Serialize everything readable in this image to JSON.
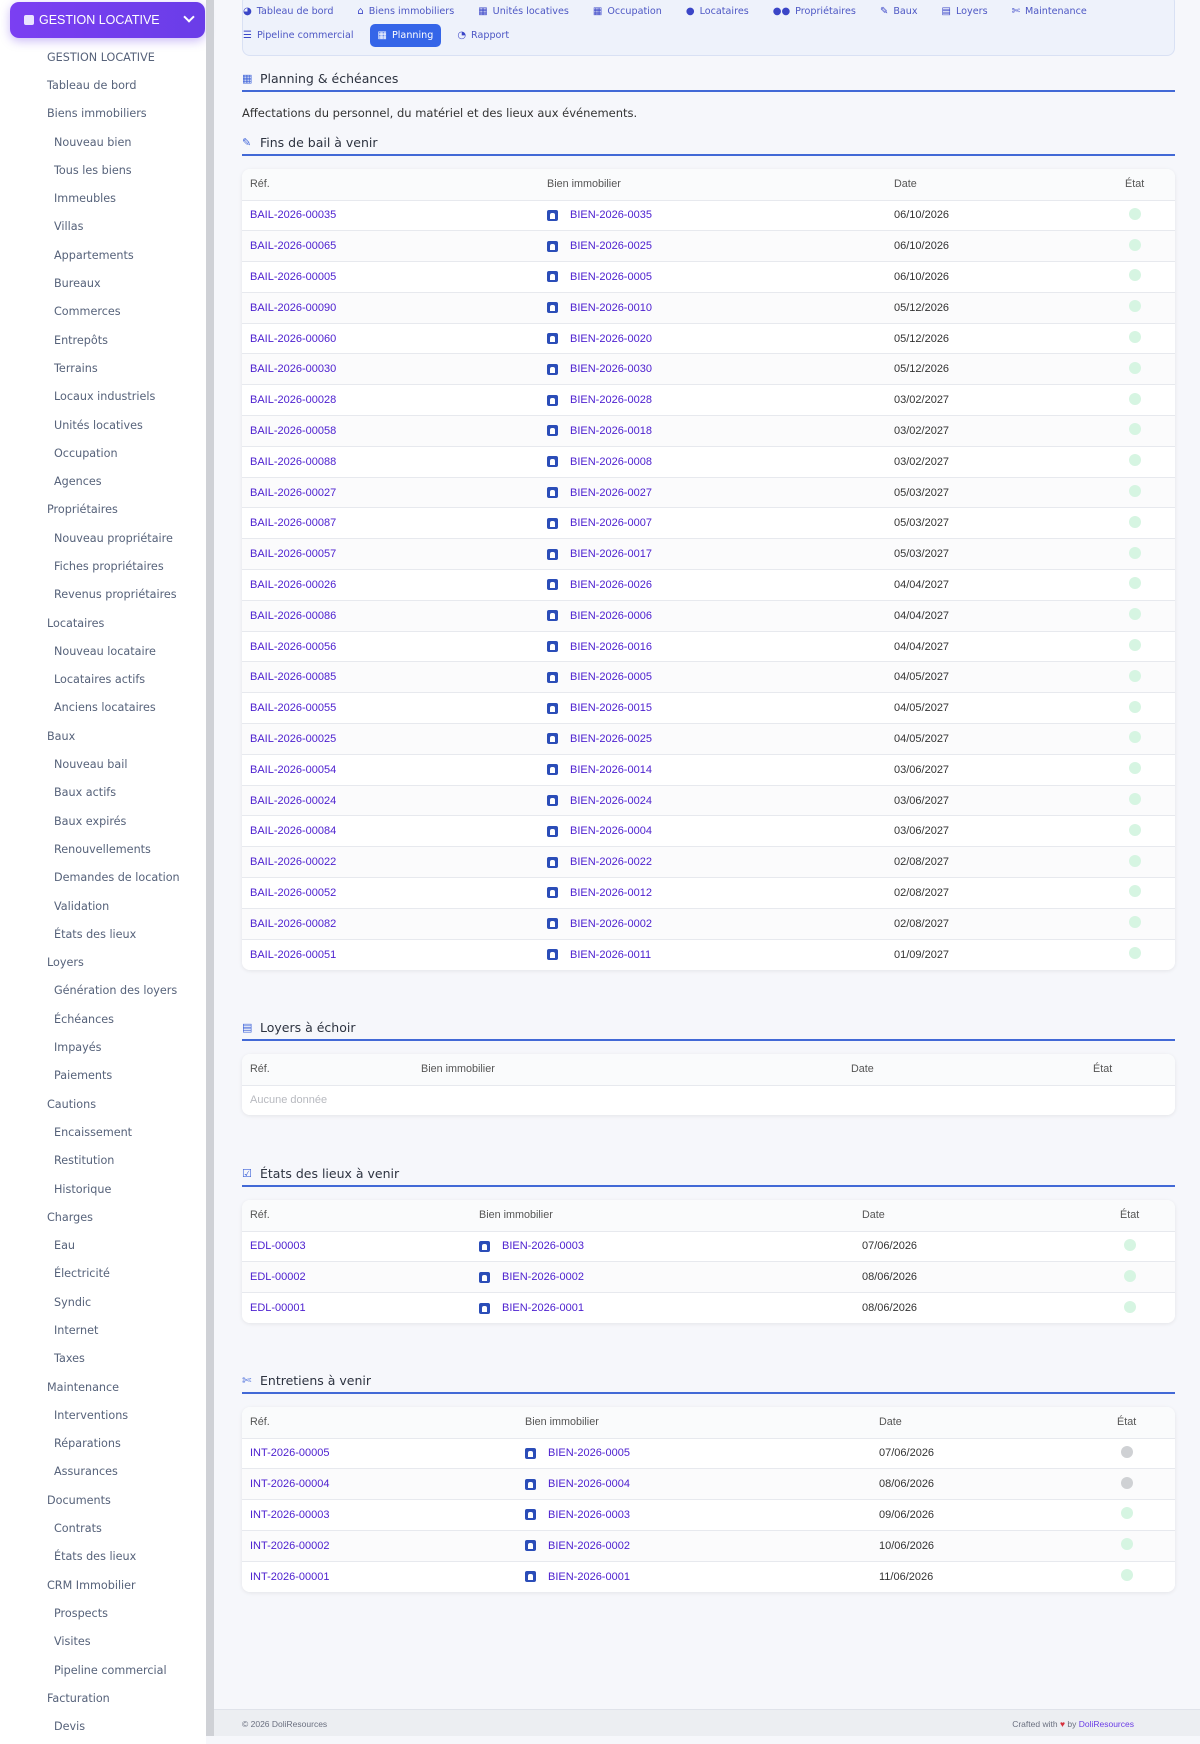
{
  "brand": {
    "label": "GESTION LOCATIVE",
    "icon": "house-icon"
  },
  "sidebar": {
    "items": [
      {
        "label": "GESTION LOCATIVE",
        "level": 0
      },
      {
        "label": "Tableau de bord",
        "level": 0
      },
      {
        "label": "Biens immobiliers",
        "level": 0
      },
      {
        "label": "Nouveau bien",
        "level": 1
      },
      {
        "label": "Tous les biens",
        "level": 1
      },
      {
        "label": "Immeubles",
        "level": 1
      },
      {
        "label": "Villas",
        "level": 1
      },
      {
        "label": "Appartements",
        "level": 1
      },
      {
        "label": "Bureaux",
        "level": 1
      },
      {
        "label": "Commerces",
        "level": 1
      },
      {
        "label": "Entrepôts",
        "level": 1
      },
      {
        "label": "Terrains",
        "level": 1
      },
      {
        "label": "Locaux industriels",
        "level": 1
      },
      {
        "label": "Unités locatives",
        "level": 1
      },
      {
        "label": "Occupation",
        "level": 1
      },
      {
        "label": "Agences",
        "level": 1
      },
      {
        "label": "Propriétaires",
        "level": 0
      },
      {
        "label": "Nouveau propriétaire",
        "level": 1
      },
      {
        "label": "Fiches propriétaires",
        "level": 1
      },
      {
        "label": "Revenus propriétaires",
        "level": 1
      },
      {
        "label": "Locataires",
        "level": 0
      },
      {
        "label": "Nouveau locataire",
        "level": 1
      },
      {
        "label": "Locataires actifs",
        "level": 1
      },
      {
        "label": "Anciens locataires",
        "level": 1
      },
      {
        "label": "Baux",
        "level": 0
      },
      {
        "label": "Nouveau bail",
        "level": 1
      },
      {
        "label": "Baux actifs",
        "level": 1
      },
      {
        "label": "Baux expirés",
        "level": 1
      },
      {
        "label": "Renouvellements",
        "level": 1
      },
      {
        "label": "Demandes de location",
        "level": 1
      },
      {
        "label": "Validation",
        "level": 1
      },
      {
        "label": "États des lieux",
        "level": 1
      },
      {
        "label": "Loyers",
        "level": 0
      },
      {
        "label": "Génération des loyers",
        "level": 1
      },
      {
        "label": "Échéances",
        "level": 1
      },
      {
        "label": "Impayés",
        "level": 1
      },
      {
        "label": "Paiements",
        "level": 1
      },
      {
        "label": "Cautions",
        "level": 0
      },
      {
        "label": "Encaissement",
        "level": 1
      },
      {
        "label": "Restitution",
        "level": 1
      },
      {
        "label": "Historique",
        "level": 1
      },
      {
        "label": "Charges",
        "level": 0
      },
      {
        "label": "Eau",
        "level": 1
      },
      {
        "label": "Électricité",
        "level": 1
      },
      {
        "label": "Syndic",
        "level": 1
      },
      {
        "label": "Internet",
        "level": 1
      },
      {
        "label": "Taxes",
        "level": 1
      },
      {
        "label": "Maintenance",
        "level": 0
      },
      {
        "label": "Interventions",
        "level": 1
      },
      {
        "label": "Réparations",
        "level": 1
      },
      {
        "label": "Assurances",
        "level": 1
      },
      {
        "label": "Documents",
        "level": 0
      },
      {
        "label": "Contrats",
        "level": 1
      },
      {
        "label": "États des lieux",
        "level": 1
      },
      {
        "label": "CRM Immobilier",
        "level": 0
      },
      {
        "label": "Prospects",
        "level": 1
      },
      {
        "label": "Visites",
        "level": 1
      },
      {
        "label": "Pipeline commercial",
        "level": 1
      },
      {
        "label": "Facturation",
        "level": 0
      },
      {
        "label": "Devis",
        "level": 1
      }
    ]
  },
  "topnav": {
    "row1": [
      {
        "label": "Tableau de bord",
        "icon": "dashboard-icon",
        "glyph": "◕"
      },
      {
        "label": "Biens immobiliers",
        "icon": "building-icon",
        "glyph": "⌂"
      },
      {
        "label": "Unités locatives",
        "icon": "grid-icon",
        "glyph": "▦"
      },
      {
        "label": "Occupation",
        "icon": "calendar-grid-icon",
        "glyph": "▦"
      },
      {
        "label": "Locataires",
        "icon": "user-icon",
        "glyph": "●"
      },
      {
        "label": "Propriétaires",
        "icon": "users-icon",
        "glyph": "●●"
      },
      {
        "label": "Baux",
        "icon": "signature-icon",
        "glyph": "✎"
      },
      {
        "label": "Loyers",
        "icon": "file-icon",
        "glyph": "▤"
      },
      {
        "label": "Maintenance",
        "icon": "wrench-icon",
        "glyph": "✄"
      }
    ],
    "row2": [
      {
        "label": "Pipeline commercial",
        "icon": "list-icon",
        "glyph": "☰",
        "active": false
      },
      {
        "label": "Planning",
        "icon": "calendar-icon",
        "glyph": "▦",
        "active": true
      },
      {
        "label": "Rapport",
        "icon": "pie-chart-icon",
        "glyph": "◔",
        "active": false
      }
    ]
  },
  "page": {
    "title": "Planning & échéances",
    "title_icon": "calendar-icon",
    "description": "Affectations du personnel, du matériel et des lieux aux événements."
  },
  "sections": {
    "fins_bail": {
      "title": "Fins de bail à venir",
      "icon": "signature-icon",
      "headers": [
        "Réf.",
        "Bien immobilier",
        "Date",
        "État"
      ],
      "rows": [
        {
          "ref": "BAIL-2026-00035",
          "bien": "BIEN-2026-0035",
          "date": "06/10/2026",
          "etat": "green"
        },
        {
          "ref": "BAIL-2026-00065",
          "bien": "BIEN-2026-0025",
          "date": "06/10/2026",
          "etat": "green"
        },
        {
          "ref": "BAIL-2026-00005",
          "bien": "BIEN-2026-0005",
          "date": "06/10/2026",
          "etat": "green"
        },
        {
          "ref": "BAIL-2026-00090",
          "bien": "BIEN-2026-0010",
          "date": "05/12/2026",
          "etat": "green"
        },
        {
          "ref": "BAIL-2026-00060",
          "bien": "BIEN-2026-0020",
          "date": "05/12/2026",
          "etat": "green"
        },
        {
          "ref": "BAIL-2026-00030",
          "bien": "BIEN-2026-0030",
          "date": "05/12/2026",
          "etat": "green"
        },
        {
          "ref": "BAIL-2026-00028",
          "bien": "BIEN-2026-0028",
          "date": "03/02/2027",
          "etat": "green"
        },
        {
          "ref": "BAIL-2026-00058",
          "bien": "BIEN-2026-0018",
          "date": "03/02/2027",
          "etat": "green"
        },
        {
          "ref": "BAIL-2026-00088",
          "bien": "BIEN-2026-0008",
          "date": "03/02/2027",
          "etat": "green"
        },
        {
          "ref": "BAIL-2026-00027",
          "bien": "BIEN-2026-0027",
          "date": "05/03/2027",
          "etat": "green"
        },
        {
          "ref": "BAIL-2026-00087",
          "bien": "BIEN-2026-0007",
          "date": "05/03/2027",
          "etat": "green"
        },
        {
          "ref": "BAIL-2026-00057",
          "bien": "BIEN-2026-0017",
          "date": "05/03/2027",
          "etat": "green"
        },
        {
          "ref": "BAIL-2026-00026",
          "bien": "BIEN-2026-0026",
          "date": "04/04/2027",
          "etat": "green"
        },
        {
          "ref": "BAIL-2026-00086",
          "bien": "BIEN-2026-0006",
          "date": "04/04/2027",
          "etat": "green"
        },
        {
          "ref": "BAIL-2026-00056",
          "bien": "BIEN-2026-0016",
          "date": "04/04/2027",
          "etat": "green"
        },
        {
          "ref": "BAIL-2026-00085",
          "bien": "BIEN-2026-0005",
          "date": "04/05/2027",
          "etat": "green"
        },
        {
          "ref": "BAIL-2026-00055",
          "bien": "BIEN-2026-0015",
          "date": "04/05/2027",
          "etat": "green"
        },
        {
          "ref": "BAIL-2026-00025",
          "bien": "BIEN-2026-0025",
          "date": "04/05/2027",
          "etat": "green"
        },
        {
          "ref": "BAIL-2026-00054",
          "bien": "BIEN-2026-0014",
          "date": "03/06/2027",
          "etat": "green"
        },
        {
          "ref": "BAIL-2026-00024",
          "bien": "BIEN-2026-0024",
          "date": "03/06/2027",
          "etat": "green"
        },
        {
          "ref": "BAIL-2026-00084",
          "bien": "BIEN-2026-0004",
          "date": "03/06/2027",
          "etat": "green"
        },
        {
          "ref": "BAIL-2026-00022",
          "bien": "BIEN-2026-0022",
          "date": "02/08/2027",
          "etat": "green"
        },
        {
          "ref": "BAIL-2026-00052",
          "bien": "BIEN-2026-0012",
          "date": "02/08/2027",
          "etat": "green"
        },
        {
          "ref": "BAIL-2026-00082",
          "bien": "BIEN-2026-0002",
          "date": "02/08/2027",
          "etat": "green"
        },
        {
          "ref": "BAIL-2026-00051",
          "bien": "BIEN-2026-0011",
          "date": "01/09/2027",
          "etat": "green"
        }
      ]
    },
    "loyers": {
      "title": "Loyers à échoir",
      "icon": "file-icon",
      "headers": [
        "Réf.",
        "Bien immobilier",
        "Date",
        "État"
      ],
      "empty": "Aucune donnée"
    },
    "edl": {
      "title": "États des lieux à venir",
      "icon": "checkbox-icon",
      "headers": [
        "Réf.",
        "Bien immobilier",
        "Date",
        "État"
      ],
      "rows": [
        {
          "ref": "EDL-00003",
          "bien": "BIEN-2026-0003",
          "date": "07/06/2026",
          "etat": "green"
        },
        {
          "ref": "EDL-00002",
          "bien": "BIEN-2026-0002",
          "date": "08/06/2026",
          "etat": "green"
        },
        {
          "ref": "EDL-00001",
          "bien": "BIEN-2026-0001",
          "date": "08/06/2026",
          "etat": "green"
        }
      ]
    },
    "entretiens": {
      "title": "Entretiens à venir",
      "icon": "wrench-icon",
      "headers": [
        "Réf.",
        "Bien immobilier",
        "Date",
        "État"
      ],
      "rows": [
        {
          "ref": "INT-2026-00005",
          "bien": "BIEN-2026-0005",
          "date": "07/06/2026",
          "etat": "grey"
        },
        {
          "ref": "INT-2026-00004",
          "bien": "BIEN-2026-0004",
          "date": "08/06/2026",
          "etat": "grey"
        },
        {
          "ref": "INT-2026-00003",
          "bien": "BIEN-2026-0003",
          "date": "09/06/2026",
          "etat": "green"
        },
        {
          "ref": "INT-2026-00002",
          "bien": "BIEN-2026-0002",
          "date": "10/06/2026",
          "etat": "green"
        },
        {
          "ref": "INT-2026-00001",
          "bien": "BIEN-2026-0001",
          "date": "11/06/2026",
          "etat": "green"
        }
      ]
    }
  },
  "footer": {
    "left": "© 2026 DoliResources",
    "right_prefix": "Crafted with",
    "right_by": "by",
    "right_brand": "DoliResources"
  },
  "colors": {
    "accent": "#6a3de8",
    "link": "#4b1ecf",
    "active_tab": "#3565e8",
    "status_green": "#d6f5e2",
    "status_grey": "#cfd1d4"
  }
}
